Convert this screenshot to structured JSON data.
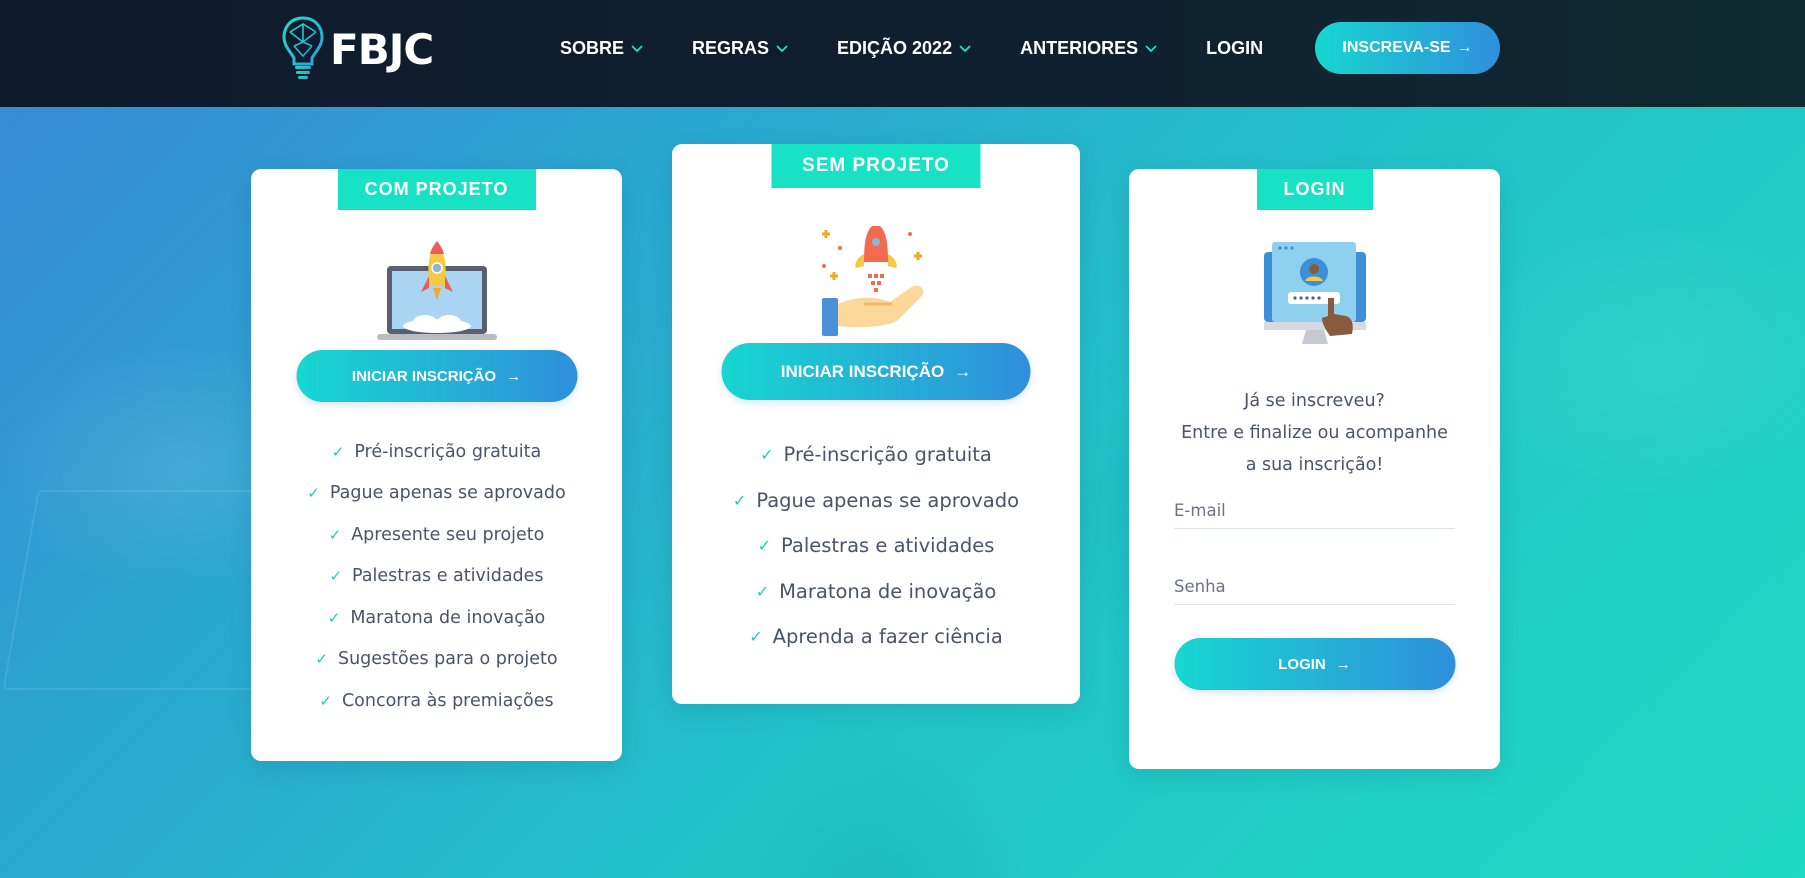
{
  "brand": {
    "logo_text": "FBJC"
  },
  "nav": {
    "items": [
      {
        "label": "SOBRE",
        "has_dropdown": true
      },
      {
        "label": "REGRAS",
        "has_dropdown": true
      },
      {
        "label": "EDIÇÃO 2022",
        "has_dropdown": true
      },
      {
        "label": "ANTERIORES",
        "has_dropdown": true
      },
      {
        "label": "LOGIN",
        "has_dropdown": false
      }
    ],
    "cta_label": "INSCREVA-SE",
    "cta_icon": "arrow-right-icon"
  },
  "colors": {
    "accent_teal": "#17e3c4",
    "gradient_start": "#17d7d0",
    "gradient_end": "#2f8fdc",
    "header_bg": "#0d1a2c",
    "check": "#1fcfb8"
  },
  "cards": {
    "com_projeto": {
      "tag": "COM PROJETO",
      "image_icon": "laptop-rocket-icon",
      "button_label": "INICIAR INSCRIÇÃO",
      "features": [
        "Pré-inscrição gratuita",
        "Pague apenas se aprovado",
        "Apresente seu projeto",
        "Palestras e atividades",
        "Maratona de inovação",
        "Sugestões para o projeto",
        "Concorra às premiações"
      ]
    },
    "sem_projeto": {
      "tag": "SEM PROJETO",
      "image_icon": "hand-rocket-icon",
      "button_label": "INICIAR INSCRIÇÃO",
      "features": [
        "Pré-inscrição gratuita",
        "Pague apenas se aprovado",
        "Palestras e atividades",
        "Maratona de inovação",
        "Aprenda a fazer ciência"
      ]
    },
    "login": {
      "tag": "LOGIN",
      "image_icon": "monitor-login-icon",
      "text_lines": [
        "Já se inscreveu?",
        "Entre e finalize ou acompanhe",
        "a sua inscrição!"
      ],
      "email_placeholder": "E-mail",
      "password_placeholder": "Senha",
      "button_label": "LOGIN"
    }
  }
}
